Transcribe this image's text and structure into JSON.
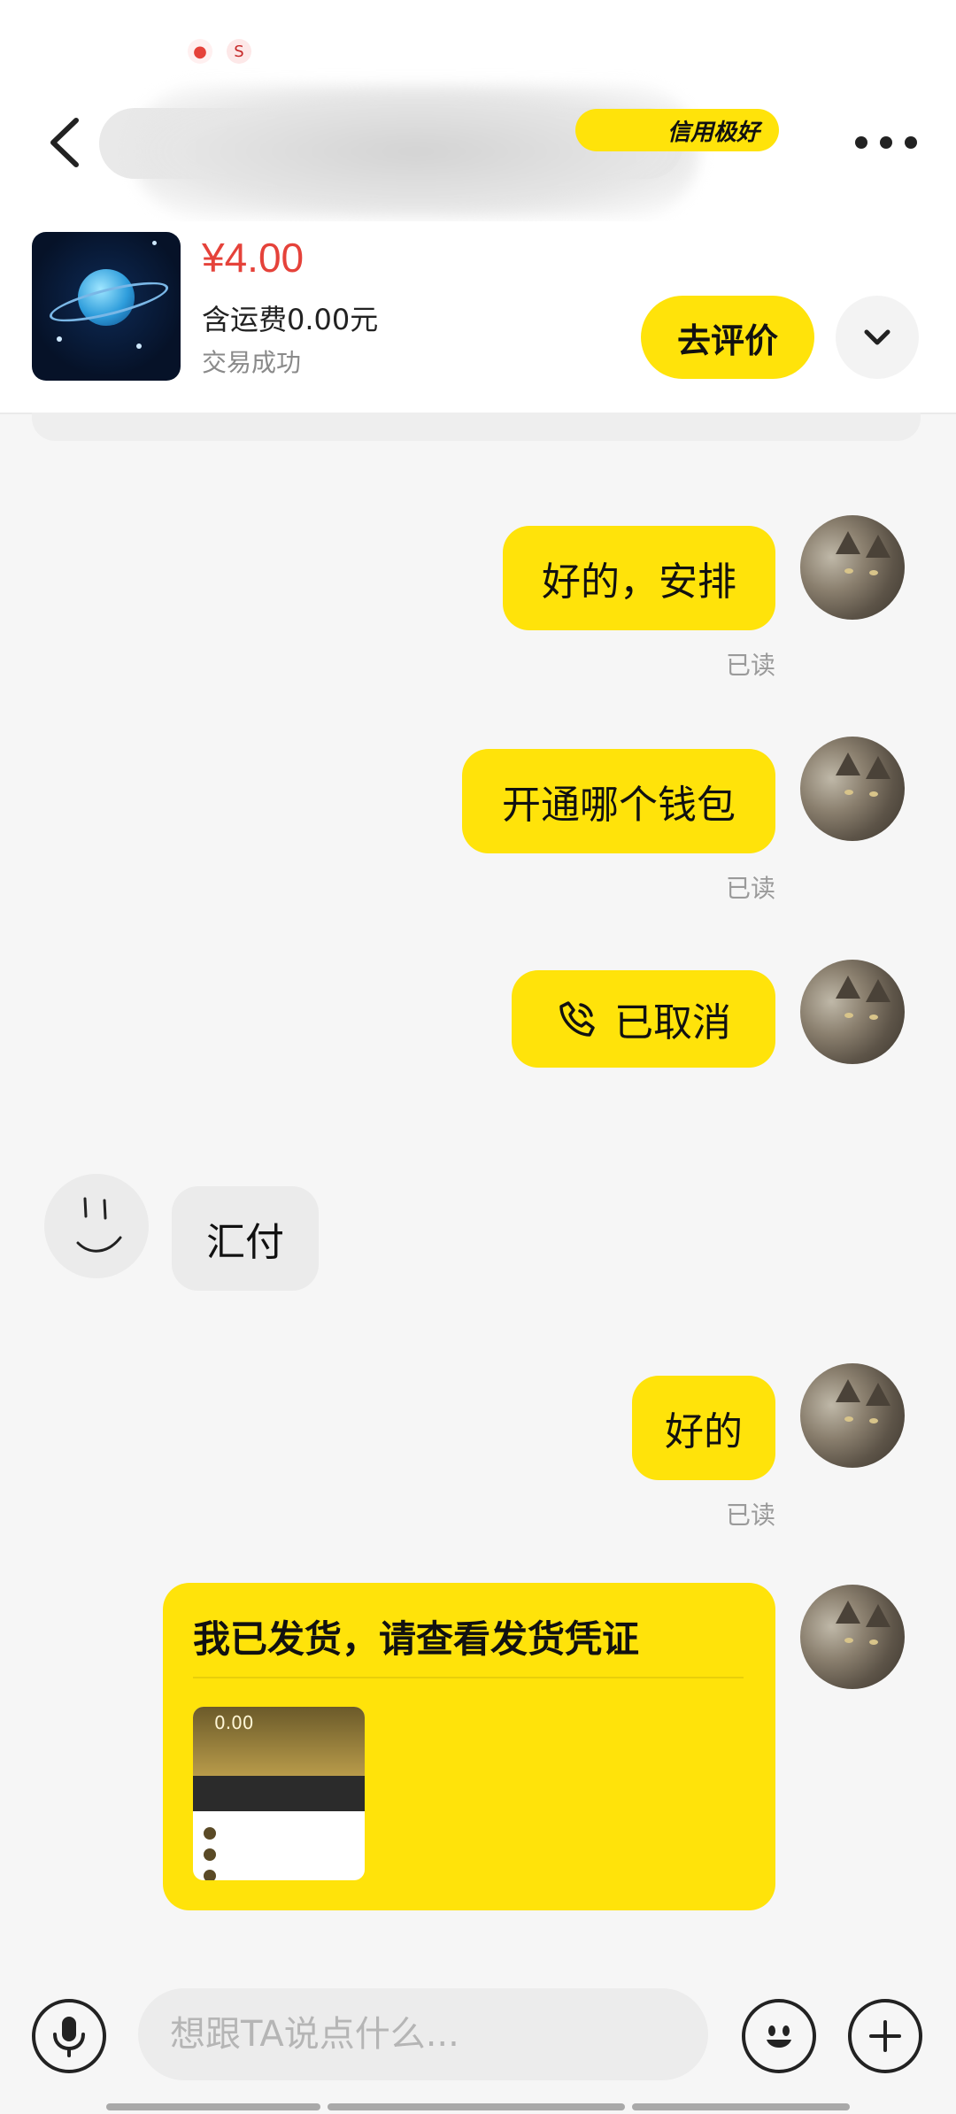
{
  "header": {
    "credit_badge": "信用极好"
  },
  "product": {
    "price": "¥4.00",
    "shipping": "含运费0.00元",
    "status": "交易成功",
    "review_button": "去评价"
  },
  "messages": [
    {
      "side": "right",
      "text": "好的，安排",
      "read": "已读"
    },
    {
      "side": "right",
      "text": "开通哪个钱包",
      "read": "已读"
    },
    {
      "side": "right",
      "type": "call",
      "text": "已取消"
    },
    {
      "side": "left",
      "text": "汇付"
    },
    {
      "side": "right",
      "text": "好的",
      "read": "已读"
    }
  ],
  "shipment_card": {
    "title": "我已发货，请查看发货凭证",
    "proof_value": "0.00"
  },
  "input": {
    "placeholder": "想跟TA说点什么..."
  },
  "icons": {
    "back": "chevron-left-icon",
    "more": "more-horizontal-icon",
    "expand": "chevron-down-icon",
    "call": "phone-call-icon",
    "mic": "microphone-icon",
    "emoji": "smiley-icon",
    "plus": "plus-icon"
  },
  "colors": {
    "accent": "#ffe30a",
    "price": "#e5423a",
    "read_text": "#9a9a9a"
  }
}
